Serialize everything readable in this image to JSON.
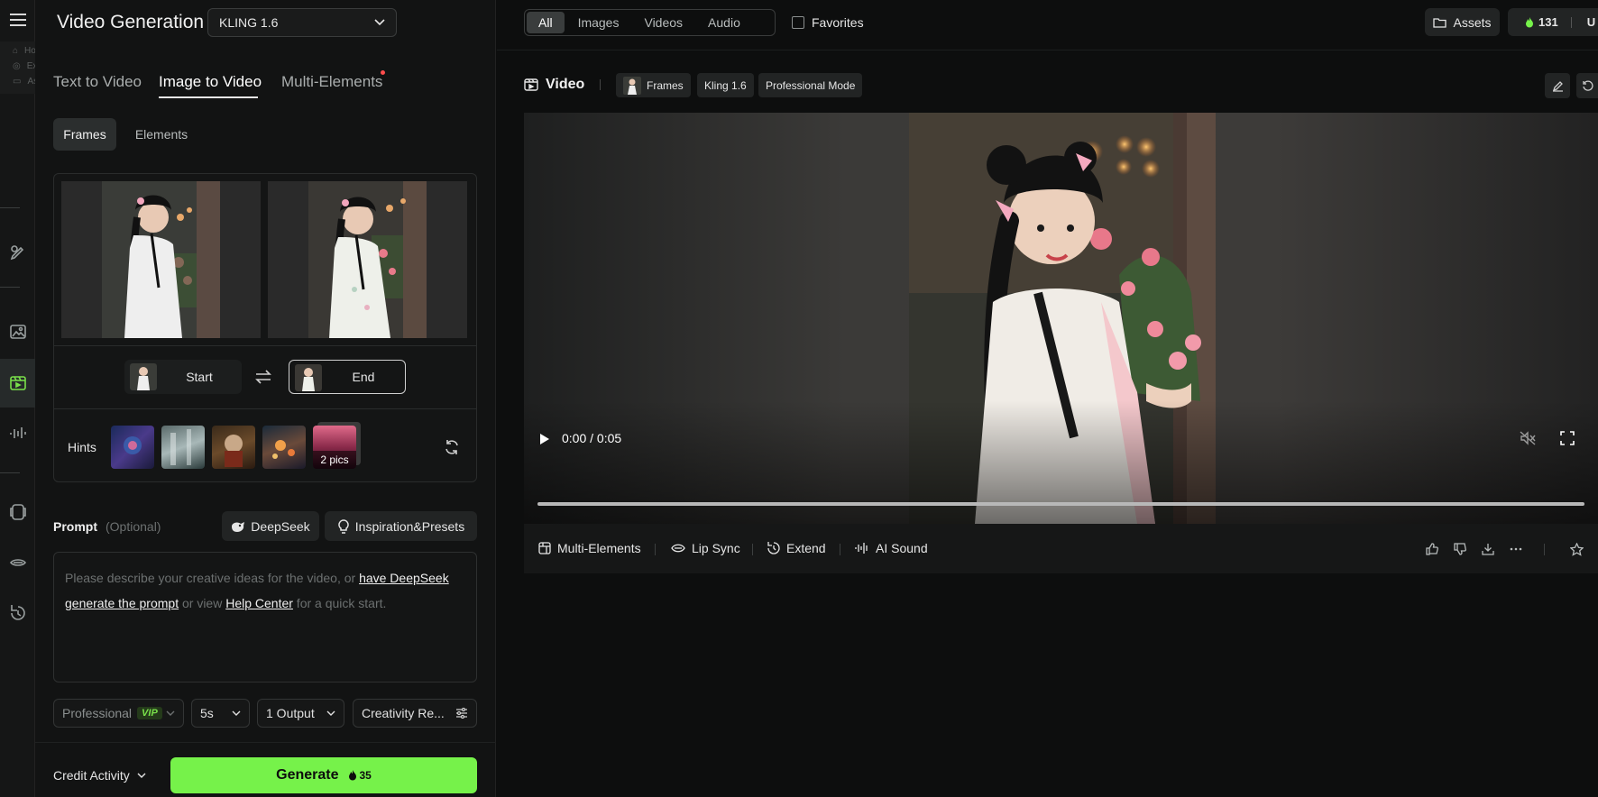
{
  "header": {
    "title": "Video Generation",
    "model": "KLING 1.6"
  },
  "nav_flyout": [
    "Home",
    "Explore",
    "Assets"
  ],
  "mode_tabs": [
    "Text to Video",
    "Image to Video",
    "Multi-Elements"
  ],
  "sub_tabs": [
    "Frames",
    "Elements"
  ],
  "frames": {
    "start_label": "Start",
    "end_label": "End"
  },
  "hints": {
    "label": "Hints",
    "more": "2 pics"
  },
  "prompt": {
    "label": "Prompt",
    "optional": "(Optional)",
    "deepseek": "DeepSeek",
    "presets": "Inspiration&Presets",
    "text_1": "Please describe your creative ideas for the video, or ",
    "link_1": "have DeepSeek generate the prompt",
    "text_2": " or view ",
    "link_2": "Help Center",
    "text_3": " for a quick start."
  },
  "controls": {
    "mode": "Professional",
    "vip": "VIP",
    "duration": "5s",
    "outputs": "1 Output",
    "creativity": "Creativity Re..."
  },
  "footer": {
    "credit": "Credit Activity",
    "generate": "Generate",
    "cost": "35"
  },
  "filters": {
    "items": [
      "All",
      "Images",
      "Videos",
      "Audio"
    ],
    "favorites": "Favorites"
  },
  "top_right": {
    "assets": "Assets",
    "credits": "131",
    "user_initial": "U"
  },
  "video_header": {
    "label": "Video",
    "chips": [
      "Frames",
      "Kling 1.6",
      "Professional Mode"
    ]
  },
  "player": {
    "time": "0:00 / 0:05",
    "progress": 0
  },
  "actions": [
    "Multi-Elements",
    "Lip Sync",
    "Extend",
    "AI Sound"
  ],
  "colors": {
    "accent": "#76f24a",
    "background": "#0d0e0e",
    "panel": "#121313"
  }
}
